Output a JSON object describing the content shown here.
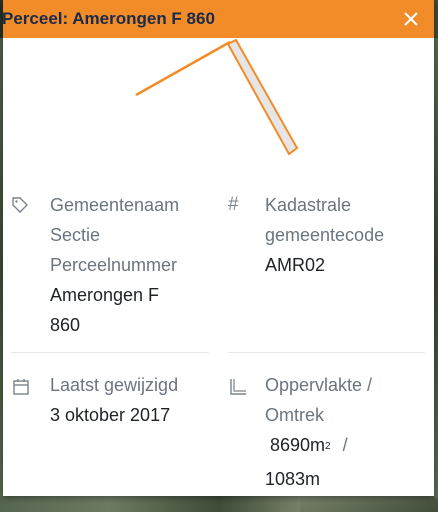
{
  "popup": {
    "title": "Perceel: Amerongen F 860",
    "close_symbol": "×"
  },
  "colors": {
    "header": "#f28c28",
    "parcel_stroke": "#f28c28",
    "parcel_fill": "#e6e6e6"
  },
  "fields": {
    "name": {
      "icon": "tag-icon",
      "labels": [
        "Gemeentenaam",
        "Sectie",
        "Perceelnummer"
      ],
      "value_line1": "Amerongen F",
      "value_line2": "860"
    },
    "code": {
      "icon": "hash-icon",
      "icon_text": "#",
      "label_line1": "Kadastrale",
      "label_line2": "gemeentecode",
      "value": "AMR02"
    },
    "date": {
      "icon": "calendar-icon",
      "label": "Laatst gewijzigd",
      "value": "3 oktober 2017"
    },
    "area": {
      "icon": "ruler-icon",
      "label_line1": "Oppervlakte /",
      "label_line2": "Omtrek",
      "area_value": "8690m",
      "area_unit_sup": "2",
      "separator": "/",
      "perimeter_value": "1083m"
    }
  }
}
